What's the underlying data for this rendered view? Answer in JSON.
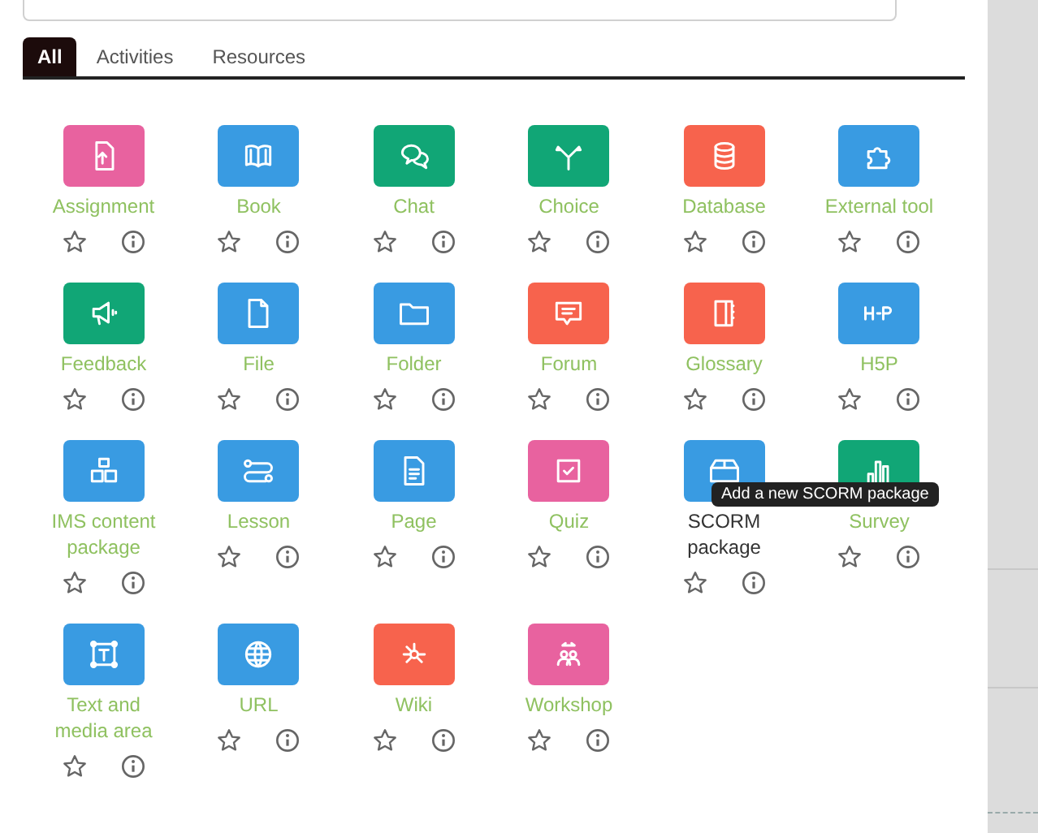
{
  "tabs": [
    {
      "label": "All",
      "selected": true
    },
    {
      "label": "Activities",
      "selected": false
    },
    {
      "label": "Resources",
      "selected": false
    }
  ],
  "modules": [
    {
      "name": "Assignment",
      "color": "#e8629f",
      "hovered": false
    },
    {
      "name": "Book",
      "color": "#399be2",
      "hovered": false
    },
    {
      "name": "Chat",
      "color": "#11a676",
      "hovered": false
    },
    {
      "name": "Choice",
      "color": "#11a676",
      "hovered": false
    },
    {
      "name": "Database",
      "color": "#f7634d",
      "hovered": false
    },
    {
      "name": "External tool",
      "color": "#399be2",
      "hovered": false
    },
    {
      "name": "Feedback",
      "color": "#11a676",
      "hovered": false
    },
    {
      "name": "File",
      "color": "#399be2",
      "hovered": false
    },
    {
      "name": "Folder",
      "color": "#399be2",
      "hovered": false
    },
    {
      "name": "Forum",
      "color": "#f7634d",
      "hovered": false
    },
    {
      "name": "Glossary",
      "color": "#f7634d",
      "hovered": false
    },
    {
      "name": "H5P",
      "color": "#399be2",
      "hovered": false
    },
    {
      "name": "IMS content package",
      "color": "#399be2",
      "hovered": false
    },
    {
      "name": "Lesson",
      "color": "#399be2",
      "hovered": false
    },
    {
      "name": "Page",
      "color": "#399be2",
      "hovered": false
    },
    {
      "name": "Quiz",
      "color": "#e8629f",
      "hovered": false
    },
    {
      "name": "SCORM package",
      "color": "#399be2",
      "hovered": true,
      "tooltip": "Add a new SCORM package"
    },
    {
      "name": "Survey",
      "color": "#11a676",
      "hovered": false
    },
    {
      "name": "Text and media area",
      "color": "#399be2",
      "hovered": false
    },
    {
      "name": "URL",
      "color": "#399be2",
      "hovered": false
    },
    {
      "name": "Wiki",
      "color": "#f7634d",
      "hovered": false
    },
    {
      "name": "Workshop",
      "color": "#e8629f",
      "hovered": false
    }
  ]
}
